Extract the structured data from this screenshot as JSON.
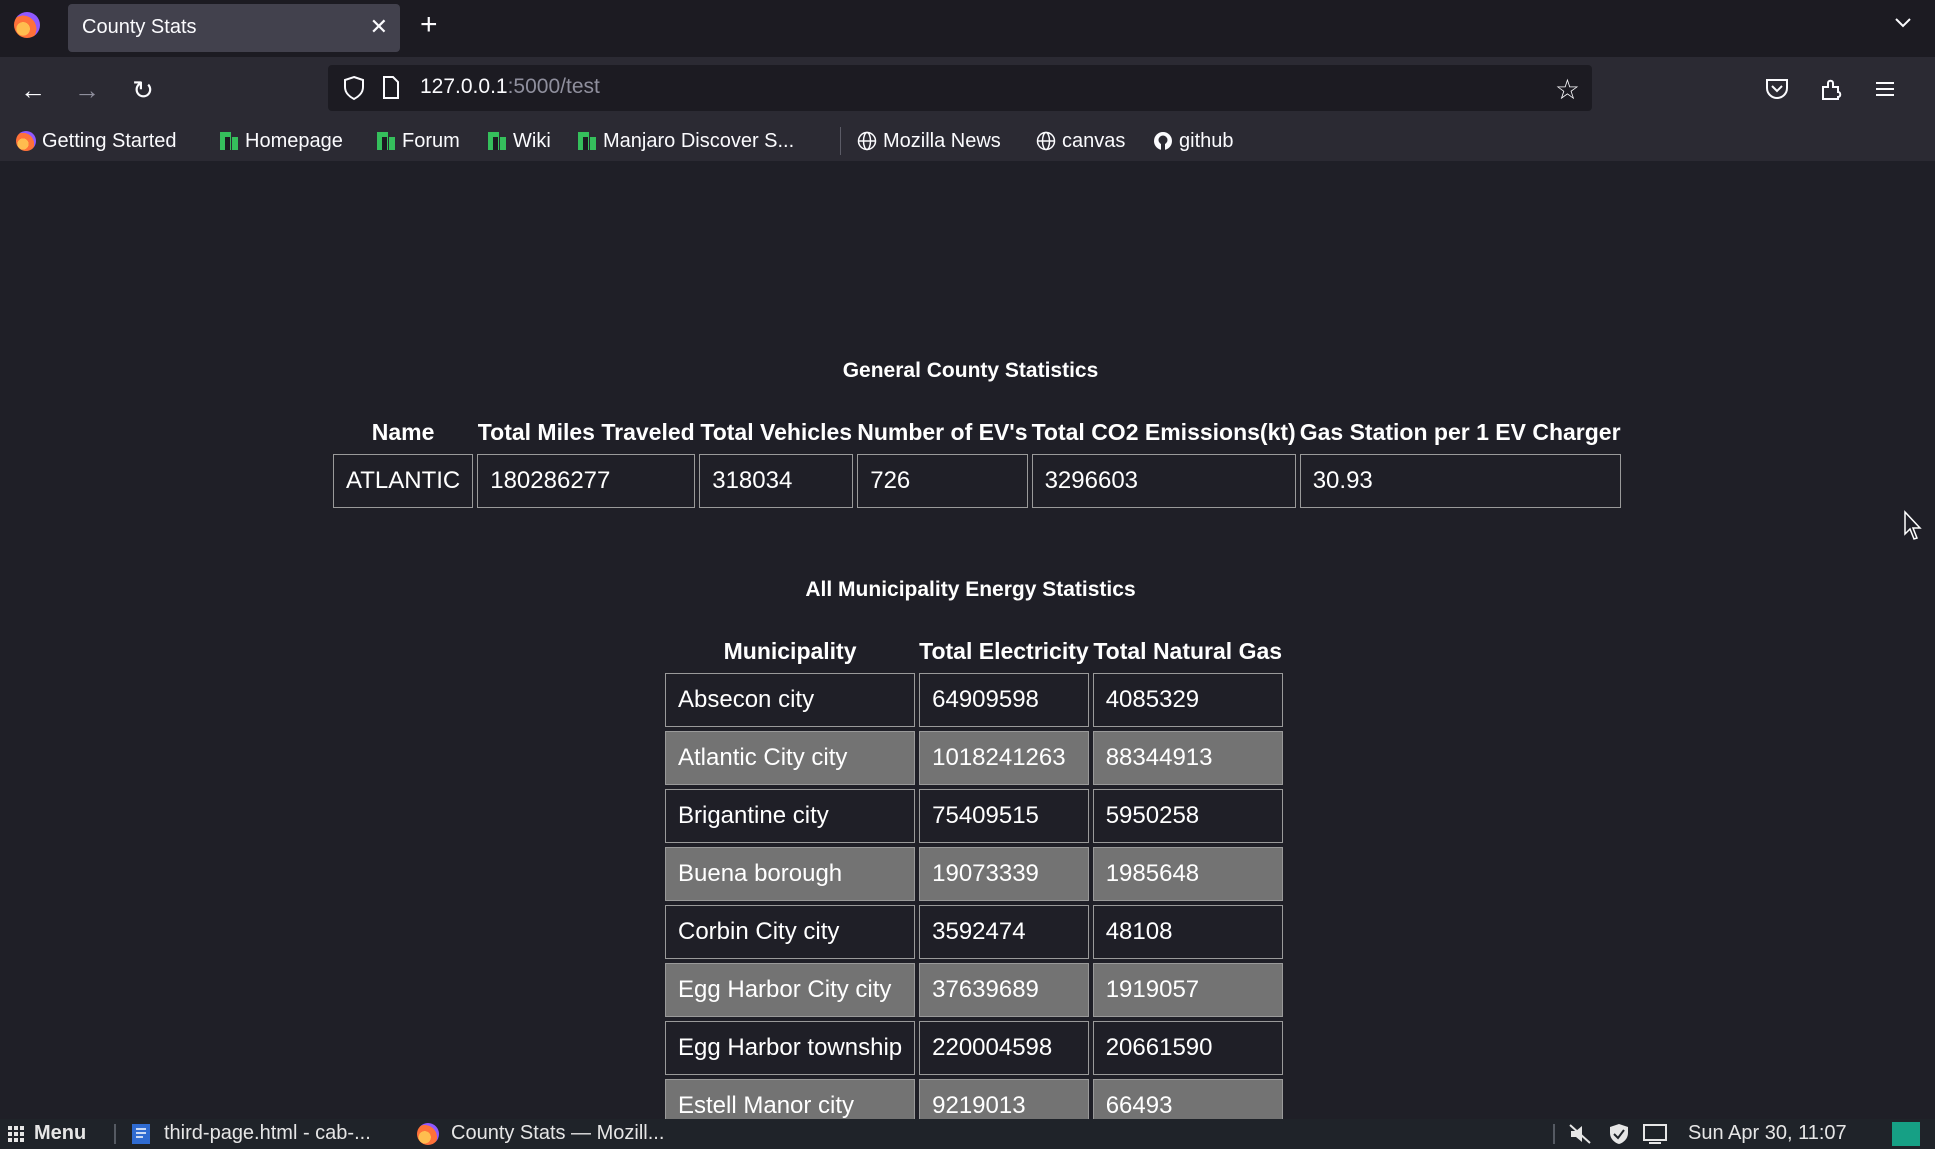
{
  "browser": {
    "tab_title": "County Stats",
    "url_host": "127.0.0.1",
    "url_path": ":5000/test",
    "bookmarks": [
      {
        "label": "Getting Started",
        "icon": "firefox-icon"
      },
      {
        "label": "Homepage",
        "icon": "manjaro-icon"
      },
      {
        "label": "Forum",
        "icon": "manjaro-icon"
      },
      {
        "label": "Wiki",
        "icon": "manjaro-icon"
      },
      {
        "label": "Manjaro Discover S...",
        "icon": "manjaro-icon"
      },
      {
        "label": "Mozilla News",
        "icon": "globe-icon"
      },
      {
        "label": "canvas",
        "icon": "globe-icon"
      },
      {
        "label": "github",
        "icon": "github-icon"
      }
    ]
  },
  "county": {
    "title": "General County Statistics",
    "headers": [
      "Name",
      "Total Miles Traveled",
      "Total Vehicles",
      "Number of EV's",
      "Total CO2 Emissions(kt)",
      "Gas Station per 1 EV Charger"
    ],
    "rows": [
      [
        "ATLANTIC",
        "180286277",
        "318034",
        "726",
        "3296603",
        "30.93"
      ]
    ]
  },
  "municipal": {
    "title": "All Municipality Energy Statistics",
    "headers": [
      "Municipality",
      "Total Electricity",
      "Total Natural Gas"
    ],
    "rows": [
      [
        "Absecon city",
        "64909598",
        "4085329"
      ],
      [
        "Atlantic City city",
        "1018241263",
        "88344913"
      ],
      [
        "Brigantine city",
        "75409515",
        "5950258"
      ],
      [
        "Buena borough",
        "19073339",
        "1985648"
      ],
      [
        "Corbin City city",
        "3592474",
        "48108"
      ],
      [
        "Egg Harbor City city",
        "37639689",
        "1919057"
      ],
      [
        "Egg Harbor township",
        "220004598",
        "20661590"
      ],
      [
        "Estell Manor city",
        "9219013",
        "66493"
      ]
    ]
  },
  "taskbar": {
    "menu_label": "Menu",
    "windows": [
      "third-page.html - cab-...",
      "County Stats — Mozill..."
    ],
    "clock": "Sun Apr 30, 11:07"
  },
  "colors": {
    "page_bg": "#1f1f27",
    "alt_row_bg": "#737373",
    "toolbar_bg": "#2b2a33",
    "accent": "#16a085"
  }
}
